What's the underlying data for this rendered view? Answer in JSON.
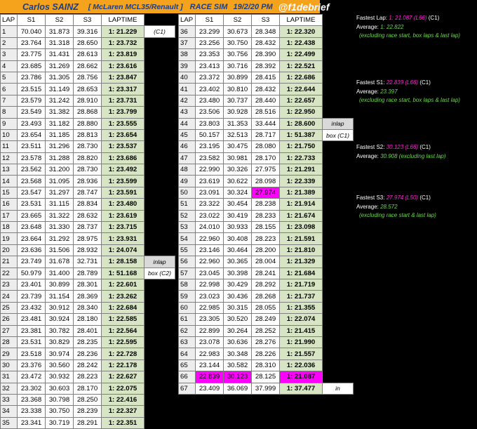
{
  "header": {
    "driver": "Carlos SAINZ",
    "car": "[ McLaren MCL35/Renault ]",
    "session": "RACE SIM",
    "date": "19/2/20 PM",
    "handle": "@f1debrief"
  },
  "columns": [
    "LAP",
    "S1",
    "S2",
    "S3",
    "LAPTIME"
  ],
  "table_left": [
    {
      "lap": "1",
      "s1": "70.040",
      "s2": "31.873",
      "s3": "39.316",
      "laptime": "1: 21.229",
      "note": "(C1)"
    },
    {
      "lap": "2",
      "s1": "23.764",
      "s2": "31.318",
      "s3": "28.650",
      "laptime": "1: 23.732",
      "note": ""
    },
    {
      "lap": "3",
      "s1": "23.775",
      "s2": "31.431",
      "s3": "28.613",
      "laptime": "1: 23.819",
      "note": ""
    },
    {
      "lap": "4",
      "s1": "23.685",
      "s2": "31.269",
      "s3": "28.662",
      "laptime": "1: 23.616",
      "note": ""
    },
    {
      "lap": "5",
      "s1": "23.786",
      "s2": "31.305",
      "s3": "28.756",
      "laptime": "1: 23.847",
      "note": ""
    },
    {
      "lap": "6",
      "s1": "23.515",
      "s2": "31.149",
      "s3": "28.653",
      "laptime": "1: 23.317",
      "note": ""
    },
    {
      "lap": "7",
      "s1": "23.579",
      "s2": "31.242",
      "s3": "28.910",
      "laptime": "1: 23.731",
      "note": ""
    },
    {
      "lap": "8",
      "s1": "23.549",
      "s2": "31.382",
      "s3": "28.868",
      "laptime": "1: 23.799",
      "note": ""
    },
    {
      "lap": "9",
      "s1": "23.493",
      "s2": "31.182",
      "s3": "28.880",
      "laptime": "1: 23.555",
      "note": ""
    },
    {
      "lap": "10",
      "s1": "23.654",
      "s2": "31.185",
      "s3": "28.813",
      "laptime": "1: 23.654",
      "note": ""
    },
    {
      "lap": "11",
      "s1": "23.511",
      "s2": "31.296",
      "s3": "28.730",
      "laptime": "1: 23.537",
      "note": ""
    },
    {
      "lap": "12",
      "s1": "23.578",
      "s2": "31.288",
      "s3": "28.820",
      "laptime": "1: 23.686",
      "note": ""
    },
    {
      "lap": "13",
      "s1": "23.562",
      "s2": "31.200",
      "s3": "28.730",
      "laptime": "1: 23.492",
      "note": ""
    },
    {
      "lap": "14",
      "s1": "23.568",
      "s2": "31.095",
      "s3": "28.936",
      "laptime": "1: 23.599",
      "note": ""
    },
    {
      "lap": "15",
      "s1": "23.547",
      "s2": "31.297",
      "s3": "28.747",
      "laptime": "1: 23.591",
      "note": ""
    },
    {
      "lap": "16",
      "s1": "23.531",
      "s2": "31.115",
      "s3": "28.834",
      "laptime": "1: 23.480",
      "note": ""
    },
    {
      "lap": "17",
      "s1": "23.665",
      "s2": "31.322",
      "s3": "28.632",
      "laptime": "1: 23.619",
      "note": ""
    },
    {
      "lap": "18",
      "s1": "23.648",
      "s2": "31.330",
      "s3": "28.737",
      "laptime": "1: 23.715",
      "note": ""
    },
    {
      "lap": "19",
      "s1": "23.664",
      "s2": "31.292",
      "s3": "28.975",
      "laptime": "1: 23.931",
      "note": ""
    },
    {
      "lap": "20",
      "s1": "23.636",
      "s2": "31.506",
      "s3": "28.932",
      "laptime": "1: 24.074",
      "note": ""
    },
    {
      "lap": "21",
      "s1": "23.749",
      "s2": "31.678",
      "s3": "32.731",
      "laptime": "1: 28.158",
      "note": "inlap"
    },
    {
      "lap": "22",
      "s1": "50.979",
      "s2": "31.400",
      "s3": "28.789",
      "laptime": "1: 51.168",
      "note": "box (C2)"
    },
    {
      "lap": "23",
      "s1": "23.401",
      "s2": "30.899",
      "s3": "28.301",
      "laptime": "1: 22.601",
      "note": ""
    },
    {
      "lap": "24",
      "s1": "23.739",
      "s2": "31.154",
      "s3": "28.369",
      "laptime": "1: 23.262",
      "note": ""
    },
    {
      "lap": "25",
      "s1": "23.432",
      "s2": "30.912",
      "s3": "28.340",
      "laptime": "1: 22.684",
      "note": ""
    },
    {
      "lap": "26",
      "s1": "23.481",
      "s2": "30.924",
      "s3": "28.180",
      "laptime": "1: 22.585",
      "note": ""
    },
    {
      "lap": "27",
      "s1": "23.381",
      "s2": "30.782",
      "s3": "28.401",
      "laptime": "1: 22.564",
      "note": ""
    },
    {
      "lap": "28",
      "s1": "23.531",
      "s2": "30.829",
      "s3": "28.235",
      "laptime": "1: 22.595",
      "note": ""
    },
    {
      "lap": "29",
      "s1": "23.518",
      "s2": "30.974",
      "s3": "28.236",
      "laptime": "1: 22.728",
      "note": ""
    },
    {
      "lap": "30",
      "s1": "23.376",
      "s2": "30.560",
      "s3": "28.242",
      "laptime": "1: 22.178",
      "note": ""
    },
    {
      "lap": "31",
      "s1": "23.472",
      "s2": "30.932",
      "s3": "28.223",
      "laptime": "1: 22.627",
      "note": ""
    },
    {
      "lap": "32",
      "s1": "23.302",
      "s2": "30.603",
      "s3": "28.170",
      "laptime": "1: 22.075",
      "note": ""
    },
    {
      "lap": "33",
      "s1": "23.368",
      "s2": "30.798",
      "s3": "28.250",
      "laptime": "1: 22.416",
      "note": ""
    },
    {
      "lap": "34",
      "s1": "23.338",
      "s2": "30.750",
      "s3": "28.239",
      "laptime": "1: 22.327",
      "note": ""
    },
    {
      "lap": "35",
      "s1": "23.341",
      "s2": "30.719",
      "s3": "28.291",
      "laptime": "1: 22.351",
      "note": ""
    }
  ],
  "table_right": [
    {
      "lap": "36",
      "s1": "23.299",
      "s2": "30.673",
      "s3": "28.348",
      "laptime": "1: 22.320",
      "note": ""
    },
    {
      "lap": "37",
      "s1": "23.256",
      "s2": "30.750",
      "s3": "28.432",
      "laptime": "1: 22.438",
      "note": ""
    },
    {
      "lap": "38",
      "s1": "23.353",
      "s2": "30.756",
      "s3": "28.390",
      "laptime": "1: 22.499",
      "note": ""
    },
    {
      "lap": "39",
      "s1": "23.413",
      "s2": "30.716",
      "s3": "28.392",
      "laptime": "1: 22.521",
      "note": ""
    },
    {
      "lap": "40",
      "s1": "23.372",
      "s2": "30.899",
      "s3": "28.415",
      "laptime": "1: 22.686",
      "note": ""
    },
    {
      "lap": "41",
      "s1": "23.402",
      "s2": "30.810",
      "s3": "28.432",
      "laptime": "1: 22.644",
      "note": ""
    },
    {
      "lap": "42",
      "s1": "23.480",
      "s2": "30.737",
      "s3": "28.440",
      "laptime": "1: 22.657",
      "note": ""
    },
    {
      "lap": "43",
      "s1": "23.506",
      "s2": "30.928",
      "s3": "28.516",
      "laptime": "1: 22.950",
      "note": ""
    },
    {
      "lap": "44",
      "s1": "23.803",
      "s2": "31.353",
      "s3": "33.444",
      "laptime": "1: 28.600",
      "note": "inlap"
    },
    {
      "lap": "45",
      "s1": "50.157",
      "s2": "32.513",
      "s3": "28.717",
      "laptime": "1: 51.387",
      "note": "box (C1)"
    },
    {
      "lap": "46",
      "s1": "23.195",
      "s2": "30.475",
      "s3": "28.080",
      "laptime": "1: 21.750",
      "note": ""
    },
    {
      "lap": "47",
      "s1": "23.582",
      "s2": "30.981",
      "s3": "28.170",
      "laptime": "1: 22.733",
      "note": ""
    },
    {
      "lap": "48",
      "s1": "22.990",
      "s2": "30.326",
      "s3": "27.975",
      "laptime": "1: 21.291",
      "note": ""
    },
    {
      "lap": "49",
      "s1": "23.619",
      "s2": "30.622",
      "s3": "28.098",
      "laptime": "1: 22.339",
      "note": ""
    },
    {
      "lap": "50",
      "s1": "23.091",
      "s2": "30.324",
      "s3": "27.974",
      "laptime": "1: 21.389",
      "note": ""
    },
    {
      "lap": "51",
      "s1": "23.322",
      "s2": "30.454",
      "s3": "28.238",
      "laptime": "1: 21.914",
      "note": ""
    },
    {
      "lap": "52",
      "s1": "23.022",
      "s2": "30.419",
      "s3": "28.233",
      "laptime": "1: 21.674",
      "note": ""
    },
    {
      "lap": "53",
      "s1": "24.010",
      "s2": "30.933",
      "s3": "28.155",
      "laptime": "1: 23.098",
      "note": ""
    },
    {
      "lap": "54",
      "s1": "22.960",
      "s2": "30.408",
      "s3": "28.223",
      "laptime": "1: 21.591",
      "note": ""
    },
    {
      "lap": "55",
      "s1": "23.146",
      "s2": "30.464",
      "s3": "28.200",
      "laptime": "1: 21.810",
      "note": ""
    },
    {
      "lap": "56",
      "s1": "22.960",
      "s2": "30.365",
      "s3": "28.004",
      "laptime": "1: 21.329",
      "note": ""
    },
    {
      "lap": "57",
      "s1": "23.045",
      "s2": "30.398",
      "s3": "28.241",
      "laptime": "1: 21.684",
      "note": ""
    },
    {
      "lap": "58",
      "s1": "22.998",
      "s2": "30.429",
      "s3": "28.292",
      "laptime": "1: 21.719",
      "note": ""
    },
    {
      "lap": "59",
      "s1": "23.023",
      "s2": "30.436",
      "s3": "28.268",
      "laptime": "1: 21.737",
      "note": ""
    },
    {
      "lap": "60",
      "s1": "22.985",
      "s2": "30.315",
      "s3": "28.055",
      "laptime": "1: 21.355",
      "note": ""
    },
    {
      "lap": "61",
      "s1": "23.305",
      "s2": "30.520",
      "s3": "28.249",
      "laptime": "1: 22.074",
      "note": ""
    },
    {
      "lap": "62",
      "s1": "22.899",
      "s2": "30.264",
      "s3": "28.252",
      "laptime": "1: 21.415",
      "note": ""
    },
    {
      "lap": "63",
      "s1": "23.078",
      "s2": "30.636",
      "s3": "28.276",
      "laptime": "1: 21.990",
      "note": ""
    },
    {
      "lap": "64",
      "s1": "22.983",
      "s2": "30.348",
      "s3": "28.226",
      "laptime": "1: 21.557",
      "note": ""
    },
    {
      "lap": "65",
      "s1": "23.144",
      "s2": "30.582",
      "s3": "28.310",
      "laptime": "1: 22.036",
      "note": ""
    },
    {
      "lap": "66",
      "s1": "22.839",
      "s2": "30.123",
      "s3": "28.125",
      "laptime": "1: 21.087",
      "note": ""
    },
    {
      "lap": "67",
      "s1": "23.409",
      "s2": "36.069",
      "s3": "37.999",
      "laptime": "1: 37.477",
      "note": "in"
    }
  ],
  "highlights": {
    "lap_50_s3": true,
    "lap_66_s1": true,
    "lap_66_s2": true,
    "lap_66_laptime": true
  },
  "colors": {
    "header_bg": "#f5a21c",
    "header_text": "#1a3f8a",
    "laptime_bg": "#d8e5c4",
    "fastest": "#ff00ff",
    "green_text": "#6cd94a"
  },
  "stats": {
    "fastest_lap_label": "Fastest Lap:",
    "fastest_lap_value": "1: 21.087 (L66)",
    "fastest_lap_compound": "(C1)",
    "avg_lap_label": "Average:",
    "avg_lap_value": "1: 22.822",
    "avg_lap_note": "(excluding race start, box laps & last lap)",
    "fastest_s1_label": "Fastest S1:",
    "fastest_s1_value": "22.839 (L66)",
    "fastest_s1_compound": "(C1)",
    "avg_s1_label": "Average:",
    "avg_s1_value": "23.397",
    "avg_s1_note": "(excluding race start, box laps & last lap)",
    "fastest_s2_label": "Fastest S2:",
    "fastest_s2_value": "30.123 (L66)",
    "fastest_s2_compound": "(C1)",
    "avg_s2_label": "Average:",
    "avg_s2_value": "30.908 (excluding last lap)",
    "fastest_s3_label": "Fastest S3:",
    "fastest_s3_value": "27.974 (L50)",
    "fastest_s3_compound": "(C1)",
    "avg_s3_label": "Average:",
    "avg_s3_value": "28.572",
    "avg_s3_note": "(excluding race start & last lap)"
  }
}
